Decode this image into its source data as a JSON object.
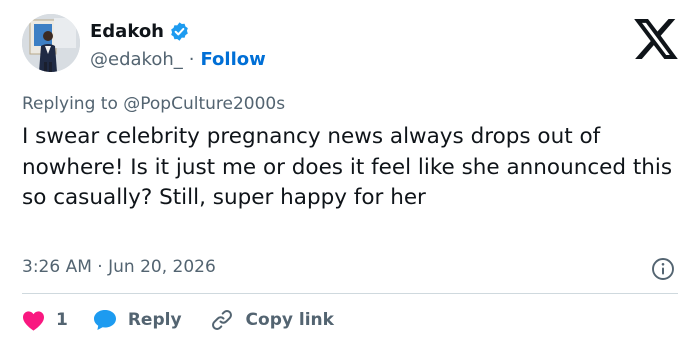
{
  "author": {
    "name": "Edakoh",
    "handle": "@edakoh_",
    "separator": "·",
    "follow_label": "Follow"
  },
  "reply_context": {
    "prefix": "Replying to",
    "mention": "@PopCulture2000s"
  },
  "tweet": {
    "text": "I swear celebrity pregnancy news always drops out of nowhere! Is it just me or does it feel like she announced this so casually? Still, super happy for her",
    "time": "3:26 AM",
    "separator": "·",
    "date": "Jun 20, 2026"
  },
  "actions": {
    "like_count": "1",
    "reply_label": "Reply",
    "copy_link_label": "Copy link"
  },
  "icons": {
    "verified": "verified-badge-icon",
    "brand": "x-logo-icon",
    "info": "info-icon",
    "like": "heart-icon",
    "reply": "speech-bubble-icon",
    "copy": "link-icon"
  },
  "colors": {
    "accent": "#1d9bf0",
    "follow": "#006fd6",
    "like": "#f91880",
    "text": "#0f1419",
    "muted": "#536471"
  }
}
